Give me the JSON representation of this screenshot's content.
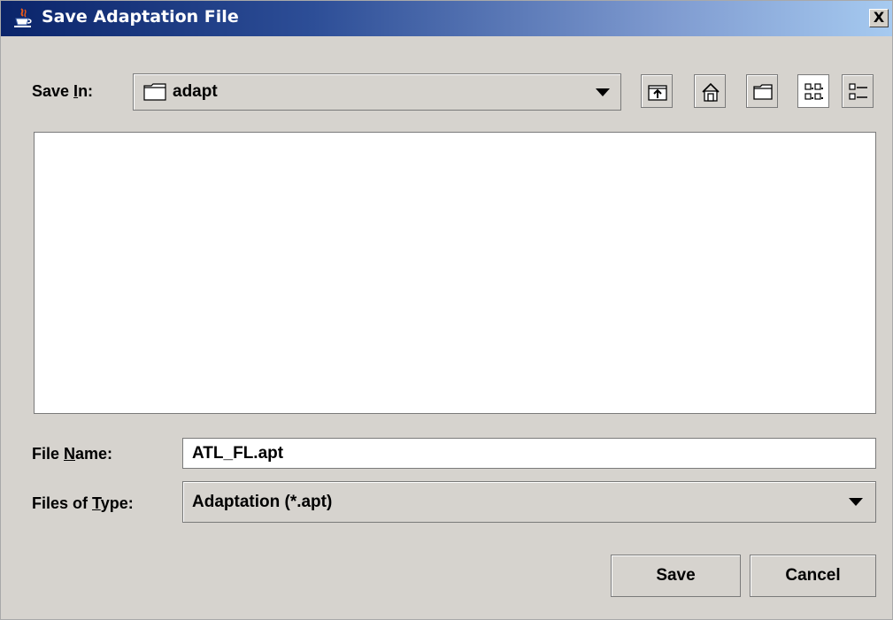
{
  "window": {
    "title": "Save Adaptation File",
    "close_glyph": "X",
    "title_icon": "java-cup-icon"
  },
  "save_in": {
    "label_pre": "Save ",
    "label_mnemonic": "I",
    "label_post": "n:",
    "value": "adapt",
    "folder_icon": "folder-icon",
    "dropdown_icon": "chevron-down-icon"
  },
  "toolbar": {
    "buttons": [
      {
        "name": "up-one-level",
        "icon": "up-folder-icon",
        "selected": false
      },
      {
        "name": "home",
        "icon": "home-icon",
        "selected": false
      },
      {
        "name": "new-folder",
        "icon": "new-folder-icon",
        "selected": false
      },
      {
        "name": "list-view",
        "icon": "list-view-icon",
        "selected": true
      },
      {
        "name": "details-view",
        "icon": "details-view-icon",
        "selected": false
      }
    ]
  },
  "file_list": {
    "items": []
  },
  "file_name": {
    "label_pre": "File ",
    "label_mnemonic": "N",
    "label_post": "ame:",
    "value": "ATL_FL.apt"
  },
  "file_type": {
    "label_pre": "Files of ",
    "label_mnemonic": "T",
    "label_post": "ype:",
    "value": "Adaptation (*.apt)"
  },
  "actions": {
    "save_label": "Save",
    "cancel_label": "Cancel"
  },
  "colors": {
    "title_gradient_start": "#0a246a",
    "title_gradient_end": "#a6caf0",
    "dialog_background": "#d6d3ce"
  }
}
